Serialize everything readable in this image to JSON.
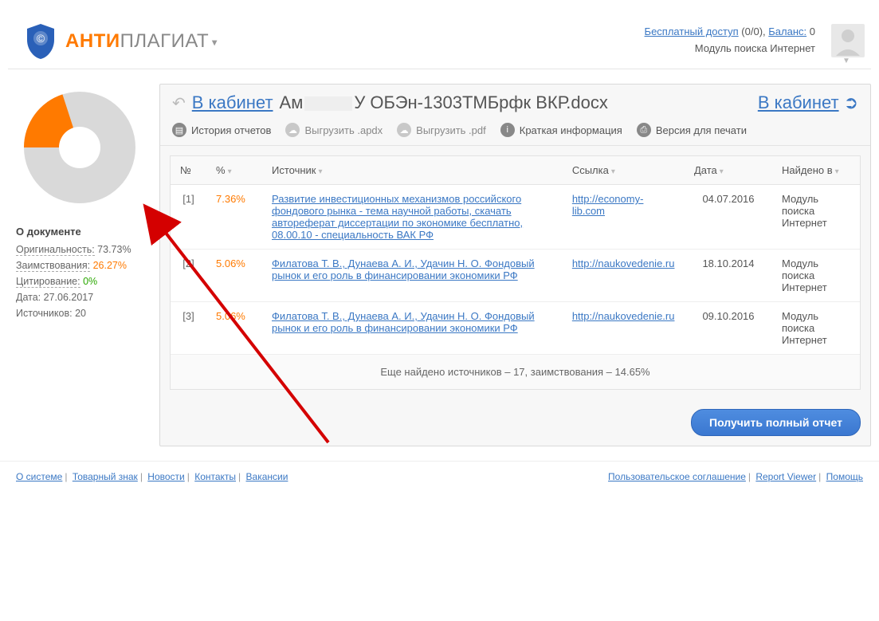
{
  "brand": {
    "anti": "АНТИ",
    "plagiat": "ПЛАГИАТ"
  },
  "header": {
    "free_access": "Бесплатный доступ",
    "free_access_count": "(0/0),",
    "balance_label": "Баланс:",
    "balance_value": "0",
    "module": "Модуль поиска Интернет"
  },
  "content_head": {
    "back_label": "В кабинет",
    "doc_prefix": "Ам",
    "doc_name": "У ОБЭн-1303ТМБрфк ВКР.docx",
    "cabinet_right": "В кабинет"
  },
  "toolbar": {
    "history": "История отчетов",
    "export_apdx": "Выгрузить .apdx",
    "export_pdf": "Выгрузить .pdf",
    "brief": "Краткая информация",
    "print": "Версия для печати"
  },
  "sidebar": {
    "about_title": "О документе",
    "orig_label": "Оригинальность:",
    "orig_value": "73.73%",
    "borrow_label": "Заимствования:",
    "borrow_value": "26.27%",
    "cite_label": "Цитирование:",
    "cite_value": "0%",
    "date_label": "Дата:",
    "date_value": "27.06.2017",
    "sources_label": "Источников:",
    "sources_value": "20"
  },
  "chart_data": {
    "type": "pie",
    "title": "",
    "series": [
      {
        "name": "Оригинальность",
        "value": 73.73,
        "color": "#d9d9d9"
      },
      {
        "name": "Заимствования",
        "value": 26.27,
        "color": "#ff7a00"
      },
      {
        "name": "Цитирование",
        "value": 0,
        "color": "#2aa700"
      }
    ]
  },
  "table": {
    "headers": {
      "num": "№",
      "pct": "%",
      "source": "Источник",
      "link": "Ссылка",
      "date": "Дата",
      "found": "Найдено в"
    },
    "rows": [
      {
        "num": "[1]",
        "pct": "7.36%",
        "source": "Развитие инвестиционных механизмов российского фондового рынка - тема научной работы, скачать автореферат диссертации по экономике бесплатно, 08.00.10 - специальность ВАК РФ",
        "link": "http://economy-lib.com",
        "date": "04.07.2016",
        "found": "Модуль поиска Интернет"
      },
      {
        "num": "[2]",
        "pct": "5.06%",
        "source": "Филатова Т. В., Дунаева А. И., Удачин Н. О. Фондовый рынок и его роль в финансировании экономики РФ",
        "link": "http://naukovedenie.ru",
        "date": "18.10.2014",
        "found": "Модуль поиска Интернет"
      },
      {
        "num": "[3]",
        "pct": "5.06%",
        "source": "Филатова Т. В., Дунаева А. И., Удачин Н. О. Фондовый рынок и его роль в финансировании экономики РФ",
        "link": "http://naukovedenie.ru",
        "date": "09.10.2016",
        "found": "Модуль поиска Интернет"
      }
    ],
    "more": "Еще найдено источников – 17, заимствования – 14.65%"
  },
  "actions": {
    "full_report": "Получить полный отчет"
  },
  "footer_left": {
    "about": "О системе",
    "trademark": "Товарный знак",
    "news": "Новости",
    "contacts": "Контакты",
    "jobs": "Вакансии"
  },
  "footer_right": {
    "agreement": "Пользовательское соглашение",
    "report_viewer": "Report Viewer",
    "help": "Помощь"
  }
}
